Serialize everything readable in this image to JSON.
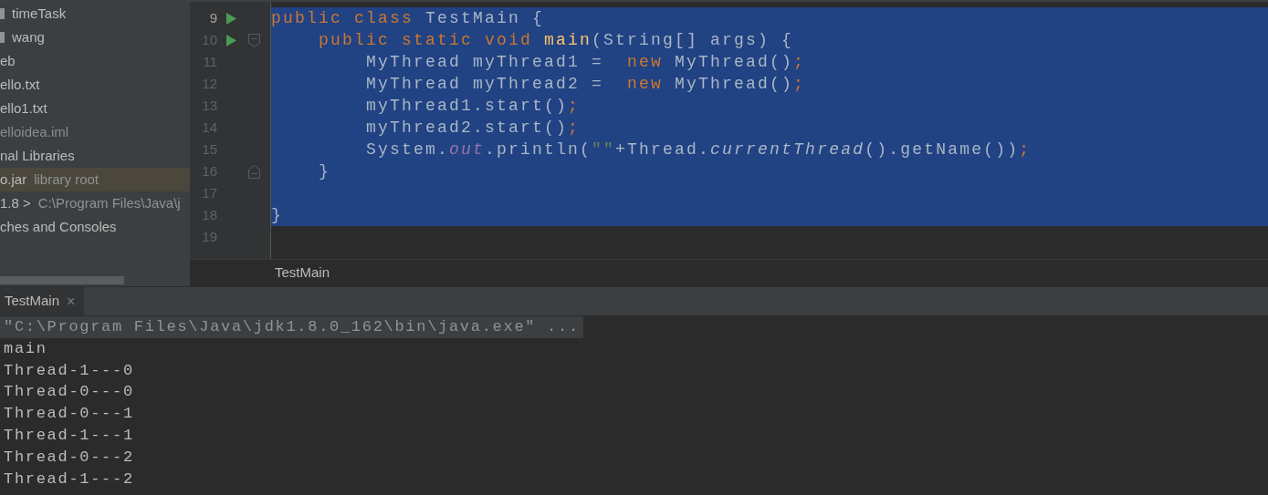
{
  "project_tree": {
    "items": [
      {
        "kind": "folder",
        "name": "timeTask",
        "selected": false,
        "dimmed": false
      },
      {
        "kind": "folder",
        "name": "wang",
        "selected": false,
        "dimmed": false
      },
      {
        "kind": "plain",
        "name": "eb",
        "selected": false,
        "dimmed": false
      },
      {
        "kind": "plain",
        "name": "ello.txt",
        "selected": false,
        "dimmed": false
      },
      {
        "kind": "plain",
        "name": "ello1.txt",
        "selected": false,
        "dimmed": false
      },
      {
        "kind": "plain",
        "name": "elloidea.iml",
        "selected": false,
        "dimmed": true
      },
      {
        "kind": "plain",
        "name": "nal Libraries",
        "selected": false,
        "dimmed": false
      },
      {
        "kind": "plain",
        "name": "o.jar",
        "detail": "library root",
        "selected": true,
        "dimmed": false
      },
      {
        "kind": "plain",
        "name": "1.8 >",
        "detail": "C:\\Program Files\\Java\\j",
        "selected": false,
        "dimmed": false
      },
      {
        "kind": "plain",
        "name": "ches and Consoles",
        "selected": false,
        "dimmed": false
      }
    ]
  },
  "editor": {
    "lines": [
      {
        "number": "9",
        "current": true,
        "run": true,
        "fold_open": false,
        "fold_close": false,
        "selected": true,
        "tokens": [
          {
            "kind": "keyword",
            "text": "public class "
          },
          {
            "kind": "plain",
            "text": "TestMain {"
          }
        ]
      },
      {
        "number": "10",
        "current": false,
        "run": true,
        "fold_open": true,
        "fold_close": false,
        "selected": true,
        "tokens": [
          {
            "kind": "keyword",
            "text": "    public static void "
          },
          {
            "kind": "method",
            "text": "main"
          },
          {
            "kind": "plain",
            "text": "(String[] args) {"
          }
        ]
      },
      {
        "number": "11",
        "current": false,
        "run": false,
        "fold_open": false,
        "fold_close": false,
        "selected": true,
        "tokens": [
          {
            "kind": "plain",
            "text": "        MyThread myThread1 =  "
          },
          {
            "kind": "keyword",
            "text": "new "
          },
          {
            "kind": "plain",
            "text": "MyThread()"
          },
          {
            "kind": "keyword",
            "text": ";"
          }
        ]
      },
      {
        "number": "12",
        "current": false,
        "run": false,
        "fold_open": false,
        "fold_close": false,
        "selected": true,
        "tokens": [
          {
            "kind": "plain",
            "text": "        MyThread myThread2 =  "
          },
          {
            "kind": "keyword",
            "text": "new "
          },
          {
            "kind": "plain",
            "text": "MyThread()"
          },
          {
            "kind": "keyword",
            "text": ";"
          }
        ]
      },
      {
        "number": "13",
        "current": false,
        "run": false,
        "fold_open": false,
        "fold_close": false,
        "selected": true,
        "tokens": [
          {
            "kind": "plain",
            "text": "        myThread1.start()"
          },
          {
            "kind": "keyword",
            "text": ";"
          }
        ]
      },
      {
        "number": "14",
        "current": false,
        "run": false,
        "fold_open": false,
        "fold_close": false,
        "selected": true,
        "tokens": [
          {
            "kind": "plain",
            "text": "        myThread2.start()"
          },
          {
            "kind": "keyword",
            "text": ";"
          }
        ]
      },
      {
        "number": "15",
        "current": false,
        "run": false,
        "fold_open": false,
        "fold_close": false,
        "selected": true,
        "tokens": [
          {
            "kind": "plain",
            "text": "        System."
          },
          {
            "kind": "field",
            "text": "out"
          },
          {
            "kind": "plain",
            "text": ".println("
          },
          {
            "kind": "string",
            "text": "\"\""
          },
          {
            "kind": "plain",
            "text": "+Thread."
          },
          {
            "kind": "static",
            "text": "currentThread"
          },
          {
            "kind": "plain",
            "text": "().getName())"
          },
          {
            "kind": "keyword",
            "text": ";"
          }
        ]
      },
      {
        "number": "16",
        "current": false,
        "run": false,
        "fold_open": false,
        "fold_close": true,
        "selected": true,
        "tokens": [
          {
            "kind": "plain",
            "text": "    }"
          }
        ]
      },
      {
        "number": "17",
        "current": false,
        "run": false,
        "fold_open": false,
        "fold_close": false,
        "selected": true
      },
      {
        "number": "18",
        "current": false,
        "run": false,
        "fold_open": false,
        "fold_close": false,
        "selected": true,
        "tokens": [
          {
            "kind": "plain",
            "text": "}"
          }
        ]
      },
      {
        "number": "19",
        "current": false,
        "run": false,
        "fold_open": false,
        "fold_close": false,
        "selected": false
      }
    ],
    "breadcrumb": "TestMain"
  },
  "run_panel": {
    "tabs": [
      {
        "label": "TestMain",
        "selected": true,
        "close": "×"
      }
    ],
    "output": [
      {
        "kind": "command",
        "text": "\"C:\\Program Files\\Java\\jdk1.8.0_162\\bin\\java.exe\" ..."
      },
      {
        "kind": "output",
        "text": "main"
      },
      {
        "kind": "output",
        "text": "Thread-1---0"
      },
      {
        "kind": "output",
        "text": "Thread-0---0"
      },
      {
        "kind": "output",
        "text": "Thread-0---1"
      },
      {
        "kind": "output",
        "text": "Thread-1---1"
      },
      {
        "kind": "output",
        "text": "Thread-0---2"
      },
      {
        "kind": "output",
        "text": "Thread-1---2"
      }
    ]
  }
}
